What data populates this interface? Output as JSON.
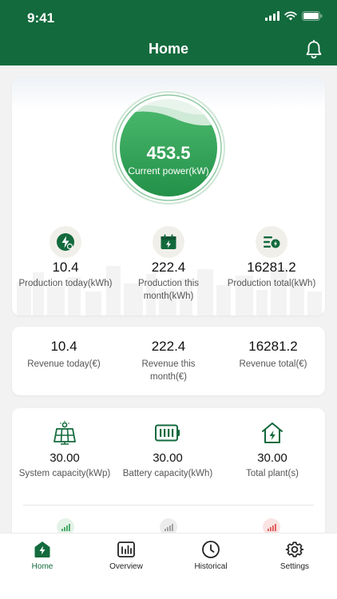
{
  "status_bar": {
    "time": "9:41"
  },
  "header": {
    "title": "Home"
  },
  "power": {
    "value": "453.5",
    "label": "Current power(kW)"
  },
  "production": [
    {
      "value": "10.4",
      "label": "Production today(kWh)",
      "icon": "lightning-circle-icon"
    },
    {
      "value": "222.4",
      "label": "Production this month(kWh)",
      "icon": "calendar-bolt-icon"
    },
    {
      "value": "16281.2",
      "label": "Production total(kWh)",
      "icon": "list-bolt-icon"
    }
  ],
  "revenue": [
    {
      "value": "10.4",
      "label": "Revenue today(€)"
    },
    {
      "value": "222.4",
      "label": "Revenue this month(€)"
    },
    {
      "value": "16281.2",
      "label": "Revenue total(€)"
    }
  ],
  "system": [
    {
      "value": "30.00",
      "label": "System capacity(kWp)",
      "icon": "solar-panel-icon"
    },
    {
      "value": "30.00",
      "label": "Battery capacity(kWh)",
      "icon": "battery-icon"
    },
    {
      "value": "30.00",
      "label": "Total plant(s)",
      "icon": "house-bolt-icon"
    }
  ],
  "tabs": [
    {
      "label": "Home",
      "icon": "home-icon",
      "active": true
    },
    {
      "label": "Overview",
      "icon": "chart-icon",
      "active": false
    },
    {
      "label": "Historical",
      "icon": "clock-icon",
      "active": false
    },
    {
      "label": "Settings",
      "icon": "gear-icon",
      "active": false
    }
  ],
  "colors": {
    "brand": "#136a3d",
    "accent": "#2fa356",
    "background": "#f2f2f2"
  }
}
